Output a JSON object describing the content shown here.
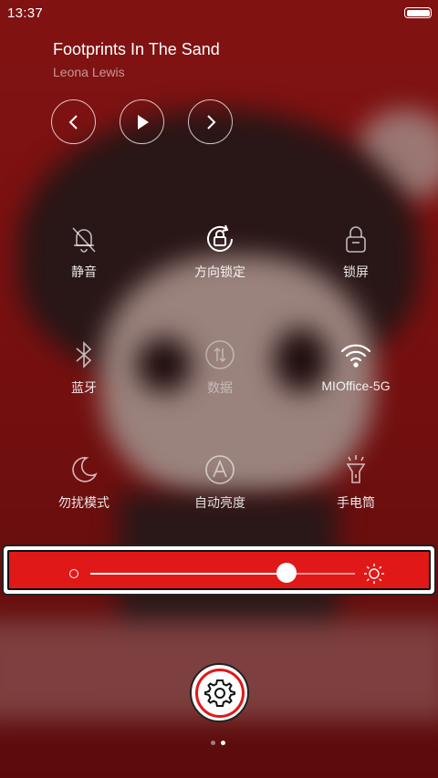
{
  "status_bar": {
    "time": "13:37",
    "battery_level": 1.0
  },
  "music": {
    "title": "Footprints In The Sand",
    "artist": "Leona Lewis",
    "controls": [
      "previous-icon",
      "play-icon",
      "next-icon"
    ]
  },
  "toggles": [
    {
      "id": "mute",
      "label": "静音",
      "icon": "bell-off-icon",
      "state": "off"
    },
    {
      "id": "rotation-lock",
      "label": "方向锁定",
      "icon": "rotation-lock-icon",
      "state": "on"
    },
    {
      "id": "lock-screen",
      "label": "锁屏",
      "icon": "lock-icon",
      "state": "off"
    },
    {
      "id": "bluetooth",
      "label": "蓝牙",
      "icon": "bluetooth-icon",
      "state": "off"
    },
    {
      "id": "data",
      "label": "数据",
      "icon": "data-icon",
      "state": "disabled"
    },
    {
      "id": "wifi",
      "label": "MIOffice-5G",
      "icon": "wifi-icon",
      "state": "on"
    },
    {
      "id": "dnd",
      "label": "勿扰模式",
      "icon": "moon-icon",
      "state": "off"
    },
    {
      "id": "auto-brightness",
      "label": "自动亮度",
      "icon": "auto-brightness-icon",
      "state": "off"
    },
    {
      "id": "flashlight",
      "label": "手电筒",
      "icon": "flashlight-icon",
      "state": "off"
    }
  ],
  "brightness": {
    "level": 0.74,
    "accent": "#e01818"
  },
  "settings": {
    "icon": "gear-icon"
  },
  "pager": {
    "count": 2,
    "active": 2
  }
}
